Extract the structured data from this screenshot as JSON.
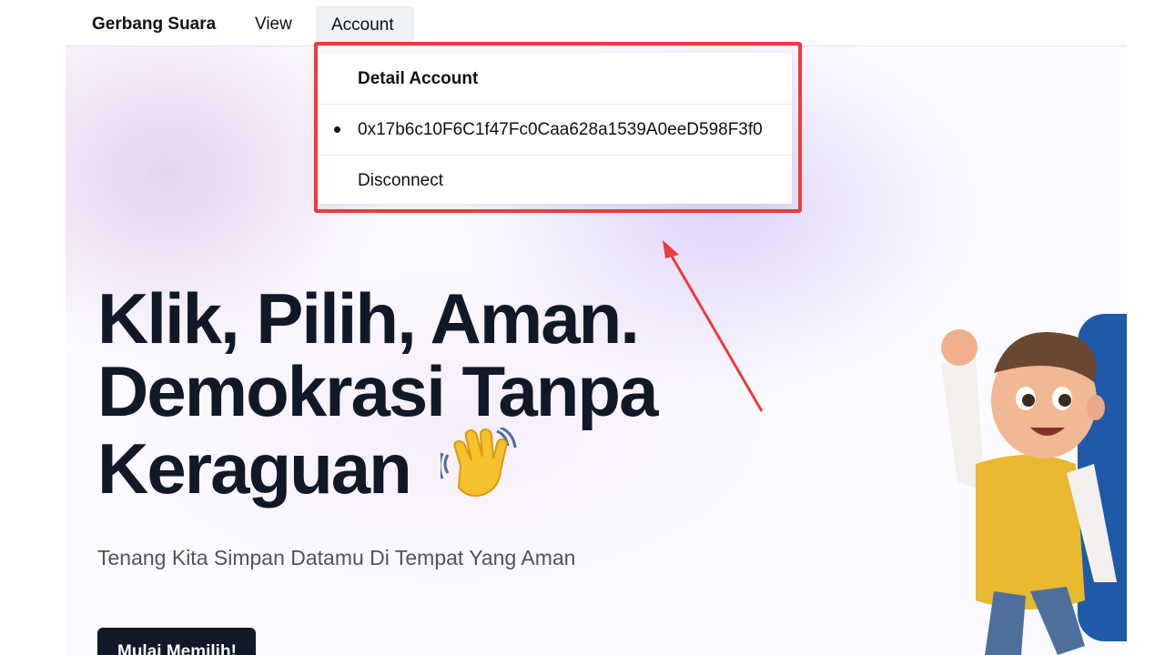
{
  "navbar": {
    "brand": "Gerbang Suara",
    "view_label": "View",
    "account_label": "Account"
  },
  "dropdown": {
    "header": "Detail Account",
    "address": "0x17b6c10F6C1f47Fc0Caa628a1539A0eeD598F3f0",
    "disconnect_label": "Disconnect"
  },
  "hero": {
    "headline_line1": "Klik, Pilih, Aman.",
    "headline_line2": "Demokrasi Tanpa",
    "headline_line3": "Keraguan",
    "subtitle": "Tenang Kita Simpan Datamu Di Tempat Yang Aman",
    "cta_label": "Mulai Memilih!"
  },
  "colors": {
    "annotation": "#ee3b3b",
    "headline": "#111827",
    "accent_blue": "#1e5aa8"
  },
  "icons": [
    "waving-hand-icon",
    "annotation-arrow"
  ]
}
